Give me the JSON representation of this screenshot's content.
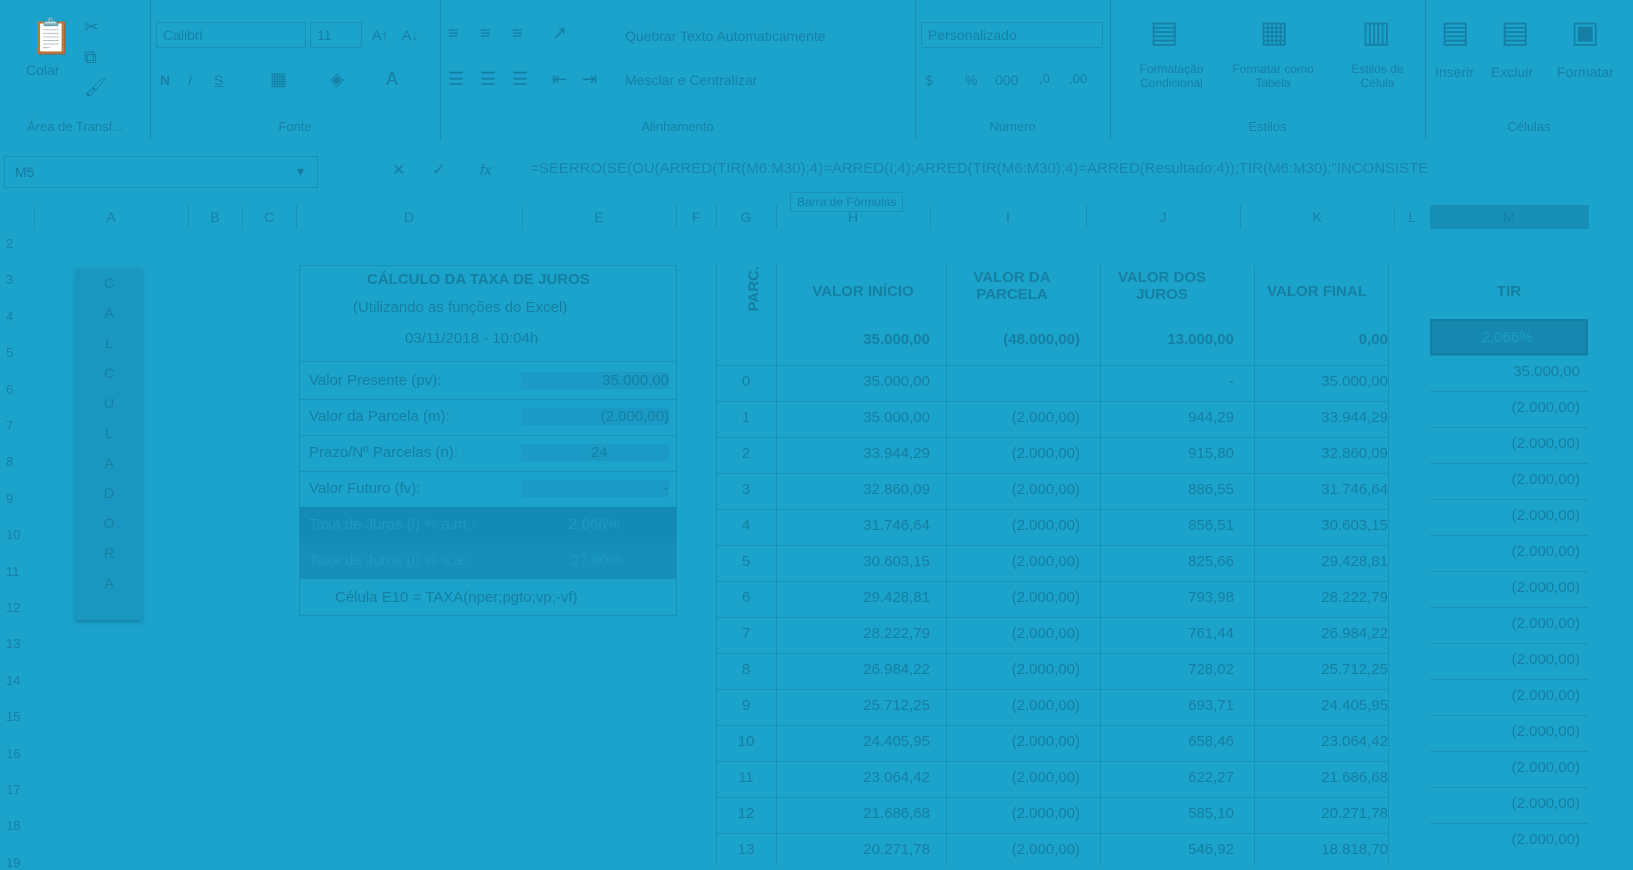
{
  "ribbon": {
    "clipboard": {
      "paste": "Colar",
      "label": "Área de Transf..."
    },
    "font": {
      "name": "Calibri",
      "size": "11",
      "bold": "N",
      "italic": "I",
      "underline": "S",
      "label": "Fonte"
    },
    "alignment": {
      "wrap": "Quebrar Texto Automaticamente",
      "merge": "Mesclar e Centralizar",
      "label": "Alinhamento"
    },
    "number": {
      "format": "Personalizado",
      "currency": "$",
      "percent": "%",
      "thousands": "000",
      "label": "Número"
    },
    "styles": {
      "conditional": "Formatação Condicional",
      "as_table": "Formatar como Tabela",
      "cell_styles": "Estilos de Célula",
      "label": "Estilos"
    },
    "cells": {
      "insert": "Inserir",
      "delete": "Excluir",
      "format": "Formatar",
      "label": "Células"
    }
  },
  "formula_bar": {
    "name_box": "M5",
    "fx": "fx",
    "formula": "=SEERRO(SE(OU(ARRED(TIR(M6:M30);4)=ARRED(I;4);ARRED(TIR(M6:M30);4)=ARRED(Resultado;4));TIR(M6:M30);\"INCONSISTE",
    "tooltip": "Barra de Fórmulas"
  },
  "columns": [
    "A",
    "B",
    "C",
    "D",
    "E",
    "F",
    "G",
    "H",
    "I",
    "J",
    "K",
    "L",
    "M"
  ],
  "rows": [
    "2",
    "3",
    "4",
    "5",
    "6",
    "7",
    "8",
    "9",
    "10",
    "11",
    "12",
    "13",
    "14",
    "15",
    "16",
    "17",
    "18",
    "19"
  ],
  "calculadora": [
    "C",
    "A",
    "L",
    "C",
    "U",
    "L",
    "A",
    "D",
    "O",
    "R",
    "A"
  ],
  "calc": {
    "title": "CÁLCULO DA TAXA DE JUROS",
    "subtitle": "(Utilizando as funções do Excel)",
    "datetime": "03/11/2018 - 10:04h",
    "rows": [
      {
        "label": "Valor Presente (pv):",
        "value": "35.000,00"
      },
      {
        "label": "Valor da Parcela (m):",
        "value": "(2.000,00)"
      },
      {
        "label": "Prazo/Nº Parcelas (n):",
        "value": "24"
      },
      {
        "label": "Valor Futuro (fv):",
        "value": "-"
      }
    ],
    "rate_month": {
      "label": "Taxa de Juros (i) % a.m.:",
      "value": "2,066%"
    },
    "rate_year": {
      "label": "Taxa de Juros (i) % a.a.:",
      "value": "27,80%"
    },
    "note": "Célula E10 = TAXA(nper;pgto;vp;-vf)"
  },
  "table": {
    "headers": {
      "parc": "PARC.",
      "start": "VALOR INÍCIO",
      "parcela": "VALOR DA PARCELA",
      "juros": "VALOR DOS JUROS",
      "final": "VALOR FINAL",
      "tir": "TIR"
    },
    "totals": {
      "start": "35.000,00",
      "parcela": "(48.000,00)",
      "juros": "13.000,00",
      "final": "0,00",
      "tir": "2,066%"
    },
    "rows": [
      {
        "n": "0",
        "start": "35.000,00",
        "parcela": "",
        "juros": "-",
        "final": "35.000,00",
        "tir": "35.000,00"
      },
      {
        "n": "1",
        "start": "35.000,00",
        "parcela": "(2.000,00)",
        "juros": "944,29",
        "final": "33.944,29",
        "tir": "(2.000,00)"
      },
      {
        "n": "2",
        "start": "33.944,29",
        "parcela": "(2.000,00)",
        "juros": "915,80",
        "final": "32.860,09",
        "tir": "(2.000,00)"
      },
      {
        "n": "3",
        "start": "32.860,09",
        "parcela": "(2.000,00)",
        "juros": "886,55",
        "final": "31.746,64",
        "tir": "(2.000,00)"
      },
      {
        "n": "4",
        "start": "31.746,64",
        "parcela": "(2.000,00)",
        "juros": "856,51",
        "final": "30.603,15",
        "tir": "(2.000,00)"
      },
      {
        "n": "5",
        "start": "30.603,15",
        "parcela": "(2.000,00)",
        "juros": "825,66",
        "final": "29.428,81",
        "tir": "(2.000,00)"
      },
      {
        "n": "6",
        "start": "29.428,81",
        "parcela": "(2.000,00)",
        "juros": "793,98",
        "final": "28.222,79",
        "tir": "(2.000,00)"
      },
      {
        "n": "7",
        "start": "28.222,79",
        "parcela": "(2.000,00)",
        "juros": "761,44",
        "final": "26.984,22",
        "tir": "(2.000,00)"
      },
      {
        "n": "8",
        "start": "26.984,22",
        "parcela": "(2.000,00)",
        "juros": "728,02",
        "final": "25.712,25",
        "tir": "(2.000,00)"
      },
      {
        "n": "9",
        "start": "25.712,25",
        "parcela": "(2.000,00)",
        "juros": "693,71",
        "final": "24.405,95",
        "tir": "(2.000,00)"
      },
      {
        "n": "10",
        "start": "24.405,95",
        "parcela": "(2.000,00)",
        "juros": "658,46",
        "final": "23.064,42",
        "tir": "(2.000,00)"
      },
      {
        "n": "11",
        "start": "23.064,42",
        "parcela": "(2.000,00)",
        "juros": "622,27",
        "final": "21.686,68",
        "tir": "(2.000,00)"
      },
      {
        "n": "12",
        "start": "21.686,68",
        "parcela": "(2.000,00)",
        "juros": "585,10",
        "final": "20.271,78",
        "tir": "(2.000,00)"
      },
      {
        "n": "13",
        "start": "20.271,78",
        "parcela": "(2.000,00)",
        "juros": "546,92",
        "final": "18.818,70",
        "tir": "(2.000,00)"
      }
    ]
  },
  "colors": {
    "overlay": "#1ba3cc",
    "text": "#157a9c",
    "highlight": "#148bb5"
  }
}
